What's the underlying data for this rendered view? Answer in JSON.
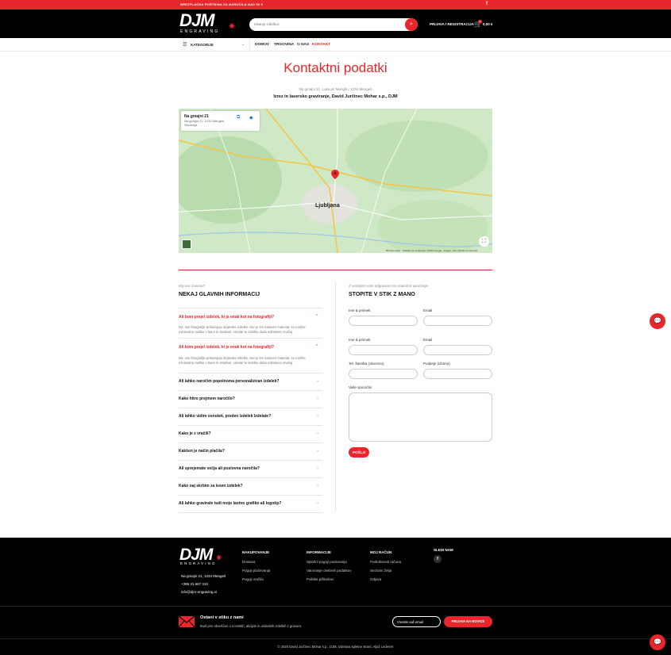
{
  "topbar": {
    "promo": "BREZPLAČNA POŠTNINA ZA NAROČILA NAD 50 €",
    "fb_icon": "facebook-icon"
  },
  "header": {
    "logo": "DJM",
    "logo_sub": "ENGRAVING",
    "search_placeholder": "Iskanje izdelkov",
    "login": "PRIJAVA / REGISTRACIJA",
    "cart_count": "0",
    "cart_amount": "0,00 €"
  },
  "nav": {
    "categories": "KATEGORIJE",
    "links": [
      "DOMOV",
      "TRGOVINA",
      "O NAS",
      "KONTAKT"
    ]
  },
  "page": {
    "title": "Kontaktni podatki",
    "address": "Na gmajni 21, Loka pri Mengšu, 1234 Mengeš",
    "company": "Izrez in lasersko graviranje, David Jurčinec Mohar s.p., DJM"
  },
  "map": {
    "card_title": "Na gmajni 21",
    "card_sub": "Na gmajni 21, 1234 Mengeš, Slovenija",
    "city": "Ljubljana",
    "attribution": "Bližnjice tipke  ·  Podatki na zemljevidu ©2026 Google  ·  Pogoji  ·  Javi napako zemljevida"
  },
  "faq": {
    "pre": "Koj vas zanima?",
    "heading": "NEKAJ GLAVNIH INFORMACIJ",
    "items": [
      {
        "q": "Ali bom prejel izdelek, ki je enak kot na fotografiji?",
        "a": "Da, vse fotografije prikazujejo dejanske izdelke. Ker je les naraven material, so možne minimalne razlike v barvi in strukturi, vendar to izdelku doda edinstven značaj."
      },
      {
        "q": "Ali bom prejel izdelek, ki je enak kot na fotografiji?",
        "a": "Da, vse fotografije prikazujejo dejanske izdelke. Ker je les naraven material, so možne minimalne razlike v barvi in strukturi, vendar to izdelku doda edinstven značaj."
      },
      {
        "q": "Ali lahko naročim popolnoma personaliziran izdelek?"
      },
      {
        "q": "Kako hitro prejmem naročilo?"
      },
      {
        "q": "Ali lahko vidim osnutek, preden izdelek izdelate?"
      },
      {
        "q": "Kako je z vračili?"
      },
      {
        "q": "Kakšen je način plačila?"
      },
      {
        "q": "Ali sprejemate večja ali poslovna naročila?"
      },
      {
        "q": "Kako naj skrbim za lesen izdelek?"
      },
      {
        "q": "Ali lahko gravirate tudi mojo lastno grafiko ali logotip?"
      }
    ]
  },
  "form": {
    "pre": "Z veseljem vam odgovorim na vsakršno vprašanje",
    "heading": "STOPITE V STIK Z MANO",
    "name": "Ime & priimek",
    "email": "Email",
    "name2": "Ime & priimek",
    "email2": "Email",
    "phone": "Tel. številka (obvezno)",
    "company": "Podjetje (izbirno)",
    "message": "Vaše sporočilo",
    "send": "POŠLJI"
  },
  "footer": {
    "logo": "DJM",
    "logo_sub": "ENGRAVING",
    "address": "Na gmajni 21, 1234 Mengeš",
    "phone": "+386 31 667 310",
    "email": "info@djm-engraving.si",
    "col1": {
      "title": "NAKUPOVANJE",
      "items": [
        "Dostava",
        "Pogoji plačevanja",
        "Pogoji vračila"
      ]
    },
    "col2": {
      "title": "INFORMACIJE",
      "items": [
        "Splošni pogoji poslovanja",
        "Varovanje osebnih podatkov",
        "Politika piškotkov"
      ]
    },
    "col3": {
      "title": "MOJ RAČUN",
      "items": [
        "Podrobnosti računa",
        "Seznam želja",
        "Odjava"
      ]
    },
    "col4": {
      "title": "SLEDI NAM"
    },
    "nl_title": "Ostani v stiku z nami",
    "nl_sub": "Bodi prvi obveščen o novostih, akcijah in unikatnih izdelkih z gravuro.",
    "nl_placeholder": "Vnesite vaš email",
    "nl_button": "PRIJAVA NA NOVICE",
    "copyright": "© 2026 David Jurčinec Mohar s.p., DJM. Izdelava spletne strani: Aljaž Ledererr"
  }
}
